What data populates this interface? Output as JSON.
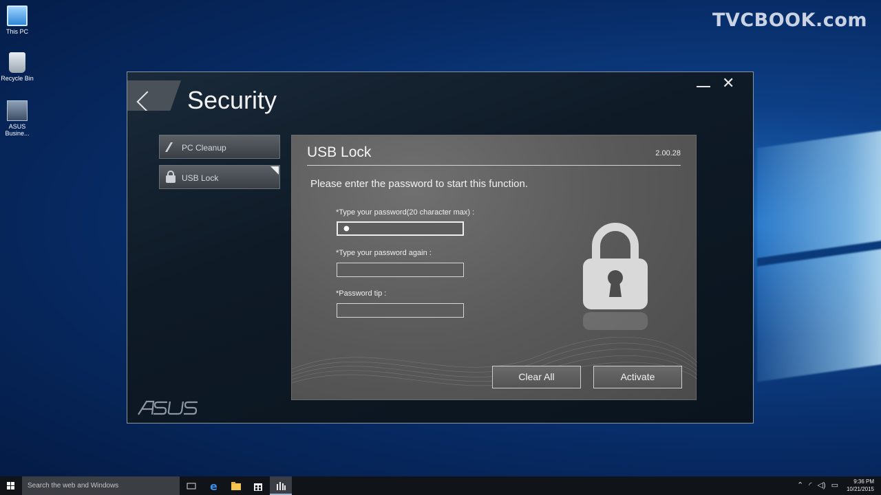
{
  "watermark": "TVCBOOK.com",
  "desktop": {
    "icons": [
      {
        "label": "This PC"
      },
      {
        "label": "Recycle Bin"
      },
      {
        "label": "ASUS Busine..."
      }
    ]
  },
  "window": {
    "title": "Security",
    "minimize_glyph": "—",
    "close_glyph": "✕",
    "brand": "/ISUS"
  },
  "sidebar": {
    "items": [
      {
        "label": "PC Cleanup",
        "icon": "broom-icon",
        "active": false
      },
      {
        "label": "USB Lock",
        "icon": "lock-icon",
        "active": true
      }
    ]
  },
  "panel": {
    "title": "USB Lock",
    "version": "2.00.28",
    "prompt": "Please enter the password to start this function.",
    "fields": [
      {
        "label": "*Type your password(20 character max) :",
        "value": "●"
      },
      {
        "label": "*Type your password again :",
        "value": ""
      },
      {
        "label": "*Password tip :",
        "value": ""
      }
    ],
    "buttons": {
      "clear": "Clear All",
      "activate": "Activate"
    }
  },
  "taskbar": {
    "search_placeholder": "Search the web and Windows",
    "time": "9:36 PM",
    "date": "10/21/2015"
  },
  "colors": {
    "panel_bg": "#5a5a5a",
    "window_bg": "#0e1a26",
    "desktop_blue": "#0d3f86"
  }
}
